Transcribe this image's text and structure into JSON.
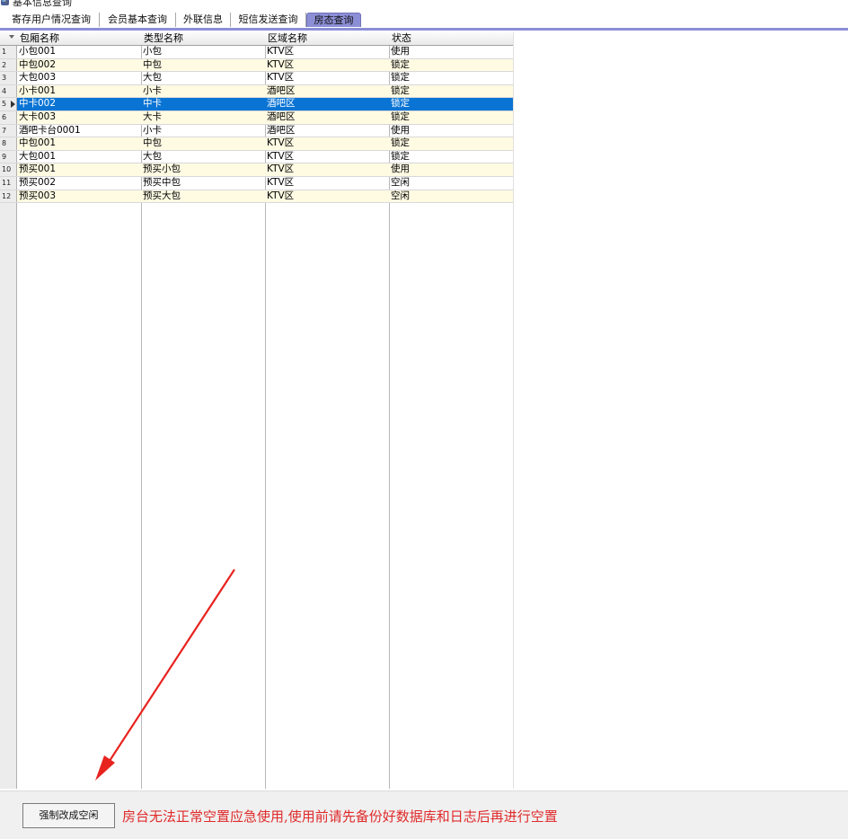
{
  "window": {
    "title": "基本信息查询",
    "icon": "search-icon"
  },
  "tabs": [
    {
      "label": "寄存用户情况查询",
      "active": false
    },
    {
      "label": "会员基本查询",
      "active": false
    },
    {
      "label": "外联信息",
      "active": false
    },
    {
      "label": "短信发送查询",
      "active": false
    },
    {
      "label": "房态查询",
      "active": true
    }
  ],
  "grid": {
    "columns": [
      "包厢名称",
      "类型名称",
      "区域名称",
      "状态"
    ],
    "selected_row": 5,
    "rows": [
      {
        "index": "1",
        "name": "小包001",
        "type": "小包",
        "area": "KTV区",
        "status": "使用"
      },
      {
        "index": "2",
        "name": "中包002",
        "type": "中包",
        "area": "KTV区",
        "status": "锁定"
      },
      {
        "index": "3",
        "name": "大包003",
        "type": "大包",
        "area": "KTV区",
        "status": "锁定"
      },
      {
        "index": "4",
        "name": "小卡001",
        "type": "小卡",
        "area": "酒吧区",
        "status": "锁定"
      },
      {
        "index": "5",
        "name": "中卡002",
        "type": "中卡",
        "area": "酒吧区",
        "status": "锁定"
      },
      {
        "index": "6",
        "name": "大卡003",
        "type": "大卡",
        "area": "酒吧区",
        "status": "锁定"
      },
      {
        "index": "7",
        "name": "酒吧卡台0001",
        "type": "小卡",
        "area": "酒吧区",
        "status": "使用"
      },
      {
        "index": "8",
        "name": "中包001",
        "type": "中包",
        "area": "KTV区",
        "status": "锁定"
      },
      {
        "index": "9",
        "name": "大包001",
        "type": "大包",
        "area": "KTV区",
        "status": "锁定"
      },
      {
        "index": "10",
        "name": "预买001",
        "type": "预买小包",
        "area": "KTV区",
        "status": "使用"
      },
      {
        "index": "11",
        "name": "预买002",
        "type": "预买中包",
        "area": "KTV区",
        "status": "空闲"
      },
      {
        "index": "12",
        "name": "预买003",
        "type": "预买大包",
        "area": "KTV区",
        "status": "空闲"
      }
    ]
  },
  "footer": {
    "force_button_label": "强制改成空闲",
    "warning_text": "房台无法正常空置应急使用,使用前请先备份好数据库和日志后再进行空置",
    "warning_color": "#e02a2a"
  },
  "colors": {
    "selection": "#0a74d4",
    "alt_row": "#fffbe3",
    "active_tab": "#8c8ed6",
    "annotation_arrow": "#e8231f"
  }
}
